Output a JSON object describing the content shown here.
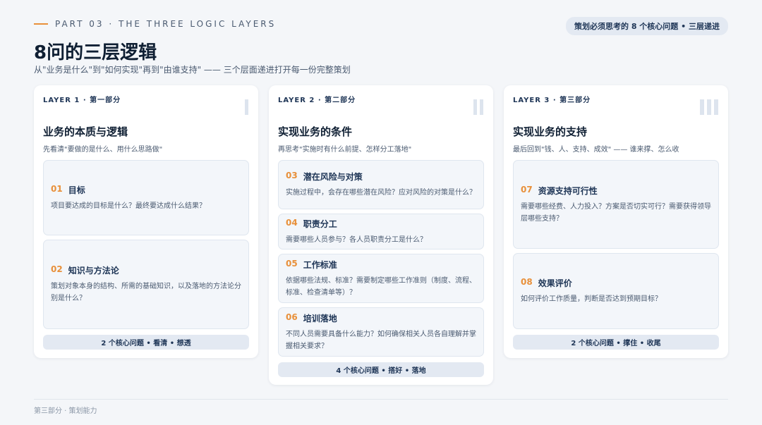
{
  "header": {
    "eyebrow": "PART 03 · THE THREE LOGIC LAYERS",
    "badge": "策划必须思考的 8 个核心问题 • 三层递进",
    "title": "8问的三层逻辑",
    "subtitle": "从\"业务是什么\"到\"如何实现\"再到\"由谁支持\" —— 三个层面递进打开每一份完整策划"
  },
  "layers": [
    {
      "label": "LAYER 1 · 第一部分",
      "title": "业务的本质与逻辑",
      "desc": "先看清\"要做的是什么、用什么思路做\"",
      "items": [
        {
          "num": "01",
          "name": "目标",
          "text": "项目要达成的目标是什么？最终要达成什么结果？"
        },
        {
          "num": "02",
          "name": "知识与方法论",
          "text": "策划对象本身的结构、所需的基础知识，以及落地的方法论分别是什么？"
        }
      ],
      "footer": "2 个核心问题 • 看清 • 想透"
    },
    {
      "label": "LAYER 2 · 第二部分",
      "title": "实现业务的条件",
      "desc": "再思考\"实施时有什么前提、怎样分工落地\"",
      "items": [
        {
          "num": "03",
          "name": "潜在风险与对策",
          "text": "实施过程中，会存在哪些潜在风险？应对风险的对策是什么？"
        },
        {
          "num": "04",
          "name": "职责分工",
          "text": "需要哪些人员参与？各人员职责分工是什么？"
        },
        {
          "num": "05",
          "name": "工作标准",
          "text": "依据哪些法规、标准？需要制定哪些工作准则（制度、流程、标准、检查清单等）？"
        },
        {
          "num": "06",
          "name": "培训落地",
          "text": "不同人员需要具备什么能力？如何确保相关人员各自理解并掌握相关要求？"
        }
      ],
      "footer": "4 个核心问题 • 搭好 • 落地"
    },
    {
      "label": "LAYER 3 · 第三部分",
      "title": "实现业务的支持",
      "desc": "最后回到\"钱、人、支持、成效\" —— 谁来撑、怎么收",
      "items": [
        {
          "num": "07",
          "name": "资源支持可行性",
          "text": "需要哪些经费、人力投入？方案是否切实可行？需要获得领导层哪些支持？"
        },
        {
          "num": "08",
          "name": "效果评价",
          "text": "如何评价工作质量，判断是否达到预期目标？"
        }
      ],
      "footer": "2 个核心问题 • 撑住 • 收尾"
    }
  ],
  "page_footer": "第三部分 · 策划能力",
  "colors": {
    "accent": "#e8903a",
    "navy": "#1e3556",
    "background": "#f4f6f9"
  }
}
